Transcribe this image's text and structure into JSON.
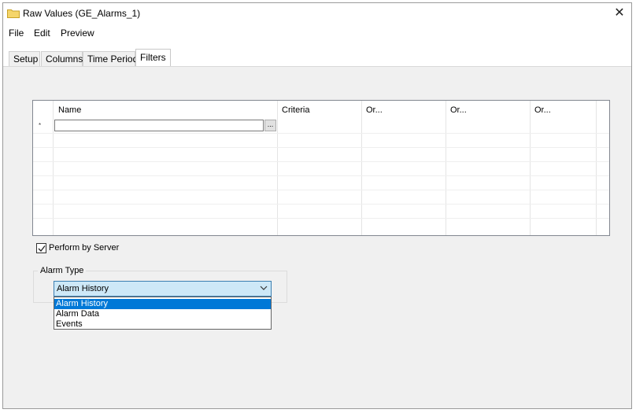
{
  "window": {
    "title": "Raw Values (GE_Alarms_1)",
    "close_glyph": "✕"
  },
  "menu": [
    "File",
    "Edit",
    "Preview"
  ],
  "tabs": [
    {
      "label": "Setup",
      "active": false
    },
    {
      "label": "Columns",
      "active": false
    },
    {
      "label": "Time Period",
      "active": false
    },
    {
      "label": "Filters",
      "active": true
    }
  ],
  "grid": {
    "columns": [
      "Name",
      "Criteria",
      "Or...",
      "Or...",
      "Or..."
    ],
    "new_row_marker": "*",
    "name_value": "",
    "ellipsis_label": "..."
  },
  "perform_by_server": {
    "label": "Perform by Server",
    "checked": true
  },
  "alarm_type": {
    "group_label": "Alarm Type",
    "selected": "Alarm History",
    "options": [
      "Alarm History",
      "Alarm Data",
      "Events"
    ],
    "highlighted_index": 0
  },
  "icons": {
    "title": "folder-icon",
    "close": "close-icon",
    "combo_arrow": "chevron-down-icon",
    "check": "check-icon"
  },
  "colors": {
    "folder": "#f5d56a",
    "selection": "#0078d7",
    "combo_fill": "#cde8f7",
    "combo_border": "#3c7fb1"
  }
}
